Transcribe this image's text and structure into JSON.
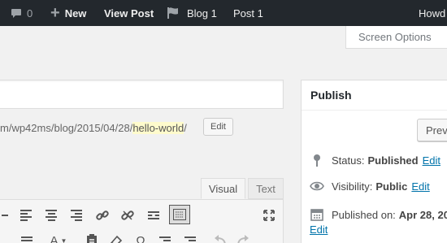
{
  "adminbar": {
    "comments_count": "0",
    "new_label": "New",
    "view_post_label": "View Post",
    "blog_label": "Blog 1",
    "post_label": "Post 1",
    "howdy_label": "Howd"
  },
  "screen_options_label": "Screen Options",
  "permalink": {
    "base": "m/wp42ms/blog/2015/04/28/",
    "slug": "hello-world",
    "trail": "/",
    "edit_label": "Edit"
  },
  "editor": {
    "tab_visual": "Visual",
    "tab_text": "Text"
  },
  "publish": {
    "title": "Publish",
    "preview_label": "Prev",
    "status_label": "Status:",
    "status_value": "Published",
    "status_edit": "Edit",
    "visibility_label": "Visibility:",
    "visibility_value": "Public",
    "visibility_edit": "Edit",
    "published_label": "Published on:",
    "published_value": "Apr 28, 20",
    "published_edit": "Edit"
  },
  "colors": {
    "adminbar_bg": "#23282d",
    "link": "#0073aa",
    "slug_highlight": "#fffbcc"
  }
}
